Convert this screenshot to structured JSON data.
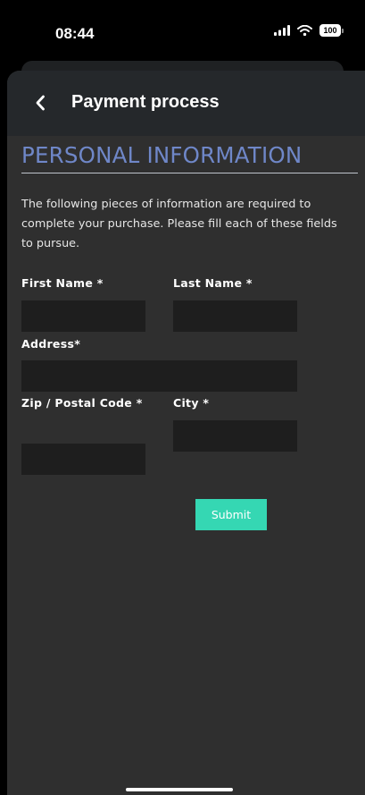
{
  "status_bar": {
    "time": "08:44",
    "battery": "100",
    "icons": [
      "cellular-signal-icon",
      "wifi-icon",
      "battery-icon"
    ]
  },
  "nav": {
    "title": "Payment process",
    "back_icon": "chevron-left-icon"
  },
  "form": {
    "section_title": "PERSONAL INFORMATION",
    "intro": "The following pieces of information are required to complete your purchase. Please fill each of these fields to pursue.",
    "first_name": {
      "label": "First Name *",
      "value": ""
    },
    "last_name": {
      "label": "Last Name *",
      "value": ""
    },
    "address": {
      "label": "Address*",
      "value": ""
    },
    "zip": {
      "label": "Zip / Postal Code *",
      "value": ""
    },
    "city": {
      "label": "City *",
      "value": ""
    },
    "submit_label": "Submit"
  },
  "colors": {
    "sheet_background": "#2f2f2f",
    "nav_background": "#25282b",
    "section_title": "#6f87c8",
    "input_background": "#1e1e1e",
    "submit_background": "#35d7b3"
  }
}
